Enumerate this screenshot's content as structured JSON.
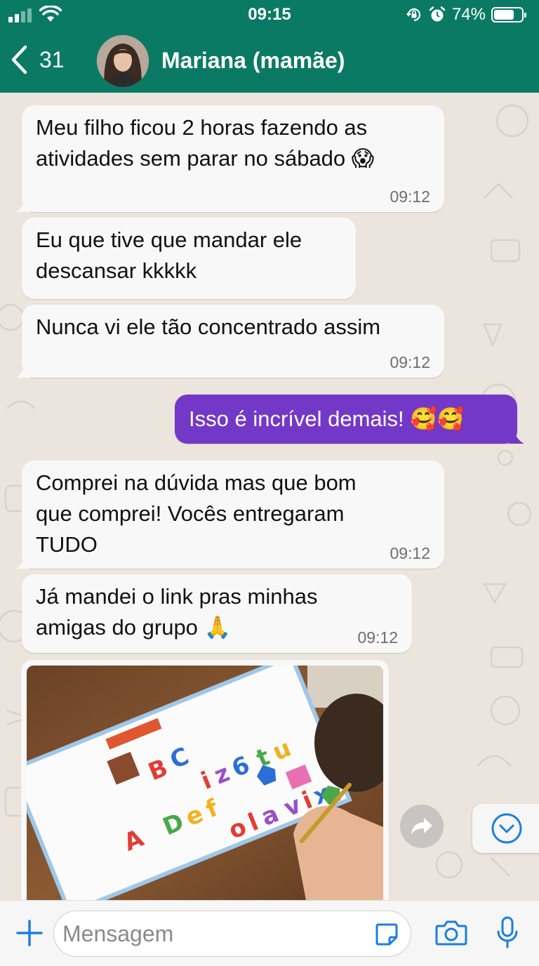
{
  "status_bar": {
    "time": "09:15",
    "battery": "74%",
    "battery_level": 0.74
  },
  "header": {
    "back_count": "31",
    "contact_name": "Mariana (mamãe)"
  },
  "messages": [
    {
      "direction": "in",
      "text": "Meu filho ficou 2 horas fazendo as\natividades sem parar no sábado 😱",
      "time": "09:12"
    },
    {
      "direction": "in",
      "text": "Eu que tive que mandar ele\ndescansar kkkkk",
      "time": ""
    },
    {
      "direction": "in",
      "text": "Nunca vi ele tão concentrado assim",
      "time": "09:12"
    },
    {
      "direction": "out",
      "text": "Isso é incrível demais! 🥰🥰",
      "time": ""
    },
    {
      "direction": "in",
      "text": "Comprei na dúvida mas que bom\nque comprei! Vocês entregaram\nTUDO",
      "time": "09:12"
    },
    {
      "direction": "in",
      "text": "Já mandei o link pras minhas\namigas do grupo 🙏",
      "time": "09:12"
    }
  ],
  "worksheet_letters": [
    "A",
    "B",
    "C",
    "D",
    "e",
    "f",
    "i",
    "z",
    "6",
    "t",
    "u",
    "o",
    "l",
    "a",
    "v",
    "i",
    "x"
  ],
  "input_bar": {
    "placeholder": "Mensagem"
  },
  "colors": {
    "header": "#0b7a65",
    "outgoing_bubble": "#7438c8",
    "incoming_bubble": "#f8f8f8",
    "accent_icons": "#1a7fe0"
  }
}
